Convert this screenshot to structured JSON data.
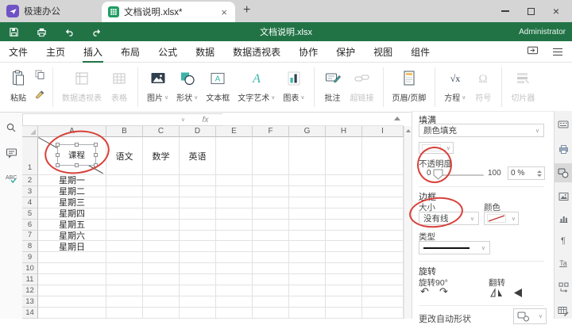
{
  "colors": {
    "brand_green": "#217346",
    "accent_teal": "#3ab5aa",
    "annotation_red": "#d8403a",
    "app_purple": "#6f52c6"
  },
  "tabbar": {
    "app_name": "极速办公",
    "tab_title": "文档说明.xlsx*",
    "close_glyph": "×",
    "new_tab_glyph": "+"
  },
  "titlebar": {
    "title": "文档说明.xlsx",
    "user": "Administrator"
  },
  "menubar": {
    "items": [
      {
        "label": "文件"
      },
      {
        "label": "主页"
      },
      {
        "label": "插入",
        "active": true
      },
      {
        "label": "布局"
      },
      {
        "label": "公式"
      },
      {
        "label": "数据"
      },
      {
        "label": "数据透视表"
      },
      {
        "label": "协作"
      },
      {
        "label": "保护"
      },
      {
        "label": "视图"
      },
      {
        "label": "组件"
      }
    ]
  },
  "ribbon": {
    "paste": "粘贴",
    "pivot_table": "数据透视表",
    "table": "表格",
    "picture": "图片",
    "shapes": "形状",
    "text_box": "文本框",
    "word_art": "文字艺术",
    "chart": "图表",
    "comment": "批注",
    "hyperlink": "超链接",
    "header_footer": "页眉/页脚",
    "equation": "方程",
    "symbol": "符号",
    "slicer": "切片器"
  },
  "formula_bar": {
    "fx_label": "fx"
  },
  "sheet": {
    "columns": [
      "A",
      "B",
      "C",
      "D",
      "E",
      "F",
      "G",
      "H",
      "I"
    ],
    "row_count": 14,
    "textbox_label": "课程",
    "subjects": {
      "B": "语文",
      "C": "数学",
      "D": "英语"
    },
    "weekdays": [
      "星期一",
      "星期二",
      "星期三",
      "星期四",
      "星期五",
      "星期六",
      "星期日"
    ],
    "weekday_start_row": 2
  },
  "panel": {
    "fill": {
      "title": "填满",
      "type_value": "颜色填充",
      "opacity_label": "不透明度",
      "slider_min": "0",
      "slider_max": "100",
      "opacity_value": "0 %"
    },
    "border": {
      "title": "边框",
      "size_label": "大小",
      "size_value": "没有线",
      "color_label": "颜色",
      "type_label": "类型"
    },
    "rotate": {
      "title": "旋转",
      "rotate_90": "旋转90°",
      "flip": "翻转"
    },
    "autoshape_label": "更改自动形状"
  }
}
